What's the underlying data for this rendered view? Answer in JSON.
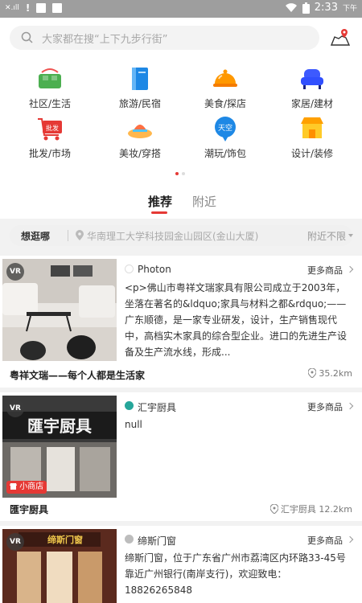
{
  "status_bar": {
    "time": "2:33",
    "ampm": "下午"
  },
  "search": {
    "placeholder": "大家都在搜“上下九步行街”"
  },
  "categories": [
    {
      "label": "社区/生活",
      "icon": "basket-icon",
      "color": "#4caf50"
    },
    {
      "label": "旅游/民宿",
      "icon": "book-icon",
      "color": "#1e88e5"
    },
    {
      "label": "美食/探店",
      "icon": "cloche-icon",
      "color": "#ff9800"
    },
    {
      "label": "家居/建材",
      "icon": "sofa-icon",
      "color": "#3d5afe"
    },
    {
      "label": "批发/市场",
      "icon": "wholesale-cart-icon",
      "color": "#e53935",
      "badge": "批发"
    },
    {
      "label": "美妆/穿搭",
      "icon": "hat-icon",
      "color": "#ff7043"
    },
    {
      "label": "潮玩/饰包",
      "icon": "trendy-icon",
      "color": "#1e88e5",
      "badge": "天空"
    },
    {
      "label": "设计/装修",
      "icon": "shop-icon",
      "color": "#ffa000"
    }
  ],
  "tabs": {
    "recommend": "推荐",
    "nearby": "附近"
  },
  "filter": {
    "label": "想逛哪",
    "address": "华南理工大学科技园金山园区(金山大厦)",
    "distance": "附近不限"
  },
  "cards": [
    {
      "vr": "VR",
      "store_name": "Photon",
      "more": "更多商品",
      "description": "<p>佛山市粤祥文瑞家具有限公司成立于2003年，坐落在著名的&ldquo;家具与材料之都&rdquo;——广东顺德，是一家专业研发，设计，生产销售现代中，高档实木家具的综合型企业。进口的先进生产设备及生产流水线，形成...",
      "title": "粤祥文瑞——每个人都是生活家",
      "distance": "35.2km"
    },
    {
      "vr": "VR",
      "store_name": "汇宇厨具",
      "more": "更多商品",
      "description": "null",
      "badge": "小商店",
      "sign": "匯宇厨具",
      "title": "匯宇厨具",
      "distance": "汇宇厨具 12.2km"
    },
    {
      "vr": "VR",
      "store_name": "缔斯门窗",
      "more": "更多商品",
      "description": "缔斯门窗，位于广东省广州市荔湾区内环路33-45号靠近广州银行(南岸支行)，欢迎致电：18826265848",
      "sign": "缔斯门窗"
    }
  ]
}
